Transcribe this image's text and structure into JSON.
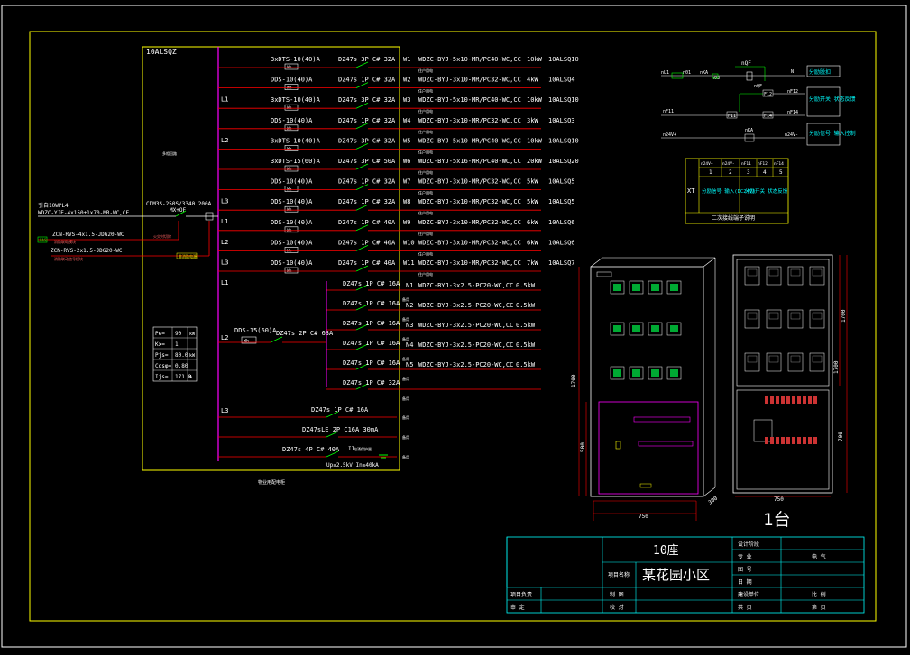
{
  "panel_id": "10ALSQZ",
  "incoming": {
    "label1": "引自10WPL4",
    "cable": "WDZC-YJE-4x150+1x70-MR-WC,CE",
    "breaker": "CDM3S-250S/3340 200A",
    "mx_label": "MX+OF"
  },
  "fire_links": [
    {
      "tag": "FAS",
      "cable": "ZCN-RVS-4x1.5-JDG20-WC"
    },
    {
      "tag": "",
      "cable": "ZCN-RVS-2x1.5-JDG20-WC"
    }
  ],
  "circuits": [
    {
      "phase": "",
      "meter": "3xDTS-10(40)A",
      "wh": "Wh",
      "breaker": "DZ47s 3P C# 32A",
      "id": "W1",
      "cable": "WDZC-BYJ-5x10-MR/PC40-WC,CC",
      "power": "10kW",
      "dest": "10ALSQ10"
    },
    {
      "phase": "L1",
      "meter": "DDS-10(40)A",
      "wh": "Wh",
      "breaker": "DZ47s 1P C# 32A",
      "id": "W2",
      "cable": "WDZC-BYJ-3x10-MR/PC32-WC,CC",
      "power": "4kW",
      "dest": "10ALSQ4"
    },
    {
      "phase": "",
      "meter": "3xDTS-10(40)A",
      "wh": "Wh",
      "breaker": "DZ47s 3P C# 32A",
      "id": "W3",
      "cable": "WDZC-BYJ-5x10-MR/PC40-WC,CC",
      "power": "10kW",
      "dest": "10ALSQ10"
    },
    {
      "phase": "L2",
      "meter": "DDS-10(40)A",
      "wh": "Wh",
      "breaker": "DZ47s 1P C# 32A",
      "id": "W4",
      "cable": "WDZC-BYJ-3x10-MR/PC32-WC,CC",
      "power": "3kW",
      "dest": "10ALSQ3"
    },
    {
      "phase": "",
      "meter": "3xDTS-10(40)A",
      "wh": "Wh",
      "breaker": "DZ47s 3P C# 32A",
      "id": "W5",
      "cable": "WDZC-BYJ-5x10-MR/PC40-WC,CC",
      "power": "10kW",
      "dest": "10ALSQ10"
    },
    {
      "phase": "",
      "meter": "3xDTS-15(60)A",
      "wh": "Wh",
      "breaker": "DZ47s 3P C# 50A",
      "id": "W6",
      "cable": "WDZC-BYJ-5x16-MR/PC40-WC,CC",
      "power": "20kW",
      "dest": "10ALSQ20"
    },
    {
      "phase": "L3",
      "meter": "DDS-10(40)A",
      "wh": "Wh",
      "breaker": "DZ47s 1P C# 32A",
      "id": "W7",
      "cable": "WDZC-BYJ-3x10-MR/PC32-WC,CC",
      "power": "5kW",
      "dest": "10ALSQ5"
    },
    {
      "phase": "L1",
      "meter": "DDS-10(40)A",
      "wh": "Wh",
      "breaker": "DZ47s 1P C# 32A",
      "id": "W8",
      "cable": "WDZC-BYJ-3x10-MR/PC32-WC,CC",
      "power": "5kW",
      "dest": "10ALSQ5"
    },
    {
      "phase": "L2",
      "meter": "DDS-10(40)A",
      "wh": "Wh",
      "breaker": "DZ47s 1P C# 40A",
      "id": "W9",
      "cable": "WDZC-BYJ-3x10-MR/PC32-WC,CC",
      "power": "6kW",
      "dest": "10ALSQ6"
    },
    {
      "phase": "L3",
      "meter": "DDS-10(40)A",
      "wh": "Wh",
      "breaker": "DZ47s 1P C# 40A",
      "id": "W10",
      "cable": "WDZC-BYJ-3x10-MR/PC32-WC,CC",
      "power": "6kW",
      "dest": "10ALSQ6"
    },
    {
      "phase": "L1",
      "meter": "DDS-10(40)A",
      "wh": "Wh",
      "breaker": "DZ47s 1P C# 40A",
      "id": "W11",
      "cable": "WDZC-BYJ-3x10-MR/PC32-WC,CC",
      "power": "7kW",
      "dest": "10ALSQ7"
    }
  ],
  "public_feeder": {
    "phase": "L2",
    "meter": "DDS-15(60)A",
    "wh": "Wh",
    "breaker": "DZ47s 2P C# 63A"
  },
  "sub_circuits": [
    {
      "breaker": "DZ47s 1P C# 16A",
      "id": "N1",
      "cable": "WDZC-BYJ-3x2.5-PC20-WC,CC",
      "power": "0.5kW"
    },
    {
      "breaker": "DZ47s 1P C# 16A",
      "id": "N2",
      "cable": "WDZC-BYJ-3x2.5-PC20-WC,CC",
      "power": "0.5kW"
    },
    {
      "breaker": "DZ47s 1P C# 16A",
      "id": "N3",
      "cable": "WDZC-BYJ-3x2.5-PC20-WC,CC",
      "power": "0.5kW"
    },
    {
      "breaker": "DZ47s 1P C# 16A",
      "id": "N4",
      "cable": "WDZC-BYJ-3x2.5-PC20-WC,CC",
      "power": "0.5kW"
    },
    {
      "breaker": "DZ47s 1P C# 16A",
      "id": "N5",
      "cable": "WDZC-BYJ-3x2.5-PC20-WC,CC",
      "power": "0.5kW"
    },
    {
      "breaker": "DZ47s 1P C# 32A",
      "id": "",
      "cable": "",
      "power": ""
    }
  ],
  "lower_circuits": [
    {
      "phase": "L3",
      "breaker": "DZ47s 1P C# 16A"
    },
    {
      "phase": "",
      "breaker": "DZ47sLE 2P C16A 30mA"
    },
    {
      "phase": "",
      "breaker": "DZ47s 4P C# 40A"
    }
  ],
  "spd": {
    "class": "II",
    "note": "Up≤2.5kV In≥40kA"
  },
  "load_table": [
    {
      "label": "Pe=",
      "value": "90",
      "unit": "kW"
    },
    {
      "label": "Kx=",
      "value": "1",
      "unit": ""
    },
    {
      "label": "Pjs=",
      "value": "80.0",
      "unit": "kW"
    },
    {
      "label": "Cosφ=",
      "value": "0.80",
      "unit": ""
    },
    {
      "label": "Ijs=",
      "value": "171.0",
      "unit": "A"
    }
  ],
  "control_diagram": {
    "qf": "nQF",
    "terminals_top": [
      "nL1",
      "n01",
      "nKA",
      "n03"
    ],
    "n": "N",
    "nf12": "nF12",
    "nf14": "nF14",
    "nf11": "nF11",
    "f12": "F12",
    "f14": "F14",
    "f11": "F11",
    "ka": "nKA",
    "v24_1": "n24V+",
    "v24_2": "n24V-",
    "btn1": "分励脱扣",
    "btn2": "分励开关 状态反馈",
    "btn3": "分励信号 输入控制"
  },
  "terminal_table": {
    "xt": "XT",
    "headers": [
      "n24V+",
      "n24V-",
      "nF11",
      "nF12",
      "nF14"
    ],
    "numbers": [
      "1",
      "2",
      "3",
      "4",
      "5"
    ],
    "cell1": "分励信号 输入(DC24V)",
    "cell2": "分励开关 状态反馈",
    "caption": "二次接线端子说明"
  },
  "cabinet": {
    "h1": "1700",
    "h2": "1700",
    "h3": "1700",
    "h4": "500",
    "w1": "750",
    "w2": "750",
    "d": "300",
    "s1": "700",
    "count": "1台"
  },
  "title_block": {
    "seat": "10座",
    "project_label": "项目名称",
    "project": "某花园小区",
    "design_phase": "设计阶段",
    "major": "专 业",
    "major_val": "电 气",
    "drawing_no": "图 号",
    "date": "日 期",
    "scale": "比 例",
    "unit": "建设单位",
    "approve": "审 定",
    "check": "校 对",
    "draw": "制 图",
    "total": "共 页",
    "page": "第 页",
    "leader": "项目负责"
  }
}
